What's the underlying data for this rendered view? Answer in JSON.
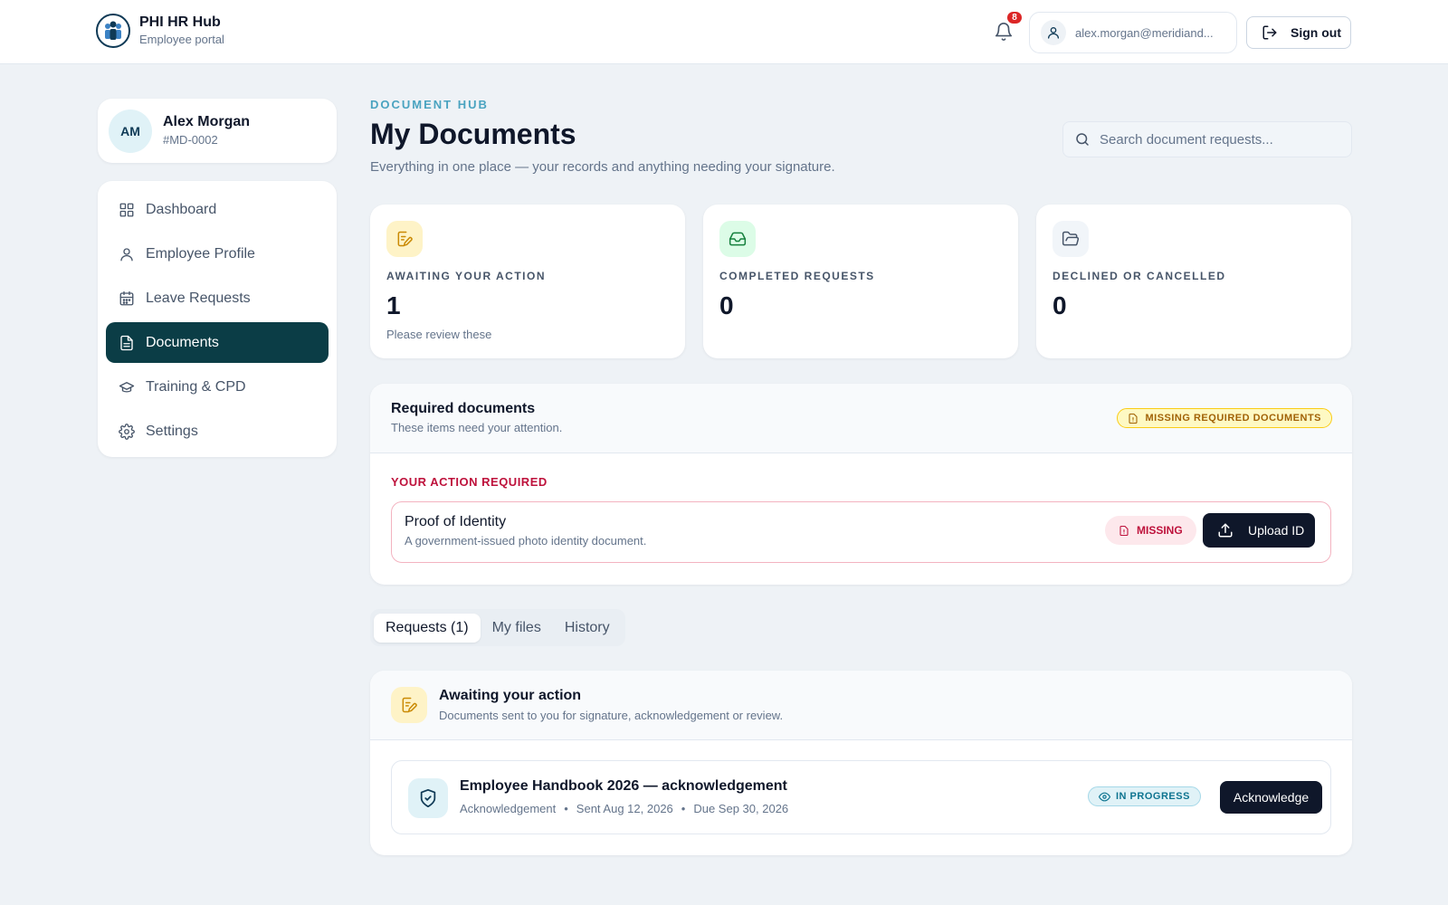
{
  "header": {
    "app_title": "PHI HR Hub",
    "app_subtitle": "Employee portal",
    "notification_count": "8",
    "user_email": "alex.morgan@meridiand...",
    "sign_out_label": "Sign out"
  },
  "profile": {
    "initials": "AM",
    "name": "Alex Morgan",
    "employee_id": "#MD-0002"
  },
  "sidebar": {
    "items": [
      {
        "label": "Dashboard",
        "icon": "grid-icon",
        "active": false
      },
      {
        "label": "Employee Profile",
        "icon": "user-icon",
        "active": false
      },
      {
        "label": "Leave Requests",
        "icon": "calendar-icon",
        "active": false
      },
      {
        "label": "Documents",
        "icon": "document-icon",
        "active": true
      },
      {
        "label": "Training & CPD",
        "icon": "graduation-cap-icon",
        "active": false
      },
      {
        "label": "Settings",
        "icon": "gear-icon",
        "active": false
      }
    ]
  },
  "main": {
    "eyebrow": "DOCUMENT HUB",
    "title": "My Documents",
    "description": "Everything in one place — your records and anything needing your signature.",
    "search_placeholder": "Search document requests..."
  },
  "stats": [
    {
      "label": "AWAITING YOUR ACTION",
      "value": "1",
      "note": "Please review these",
      "icon": "edit-document-icon",
      "color": "#fef3c7"
    },
    {
      "label": "COMPLETED REQUESTS",
      "value": "0",
      "note": "",
      "icon": "inbox-icon",
      "color": "#dcfce7"
    },
    {
      "label": "DECLINED OR CANCELLED",
      "value": "0",
      "note": "",
      "icon": "folder-icon",
      "color": "#f1f5f9"
    }
  ],
  "required": {
    "title": "Required documents",
    "subtitle": "These items need your attention.",
    "badge": "MISSING REQUIRED DOCUMENTS",
    "section_label": "YOUR ACTION REQUIRED",
    "item_title": "Proof of Identity",
    "item_desc": "A government-issued photo identity document.",
    "item_status": "MISSING",
    "item_button": "Upload ID"
  },
  "tabs": [
    {
      "label": "Requests (1)",
      "active": true
    },
    {
      "label": "My files",
      "active": false
    },
    {
      "label": "History",
      "active": false
    }
  ],
  "awaiting": {
    "title": "Awaiting your action",
    "subtitle": "Documents sent to you for signature, acknowledgement or review.",
    "doc_title": "Employee Handbook 2026 — acknowledgement",
    "doc_type": "Acknowledgement",
    "doc_sent": "Sent Aug 12, 2026",
    "doc_due": "Due Sep 30, 2026",
    "doc_status": "IN PROGRESS",
    "doc_button": "Acknowledge"
  }
}
